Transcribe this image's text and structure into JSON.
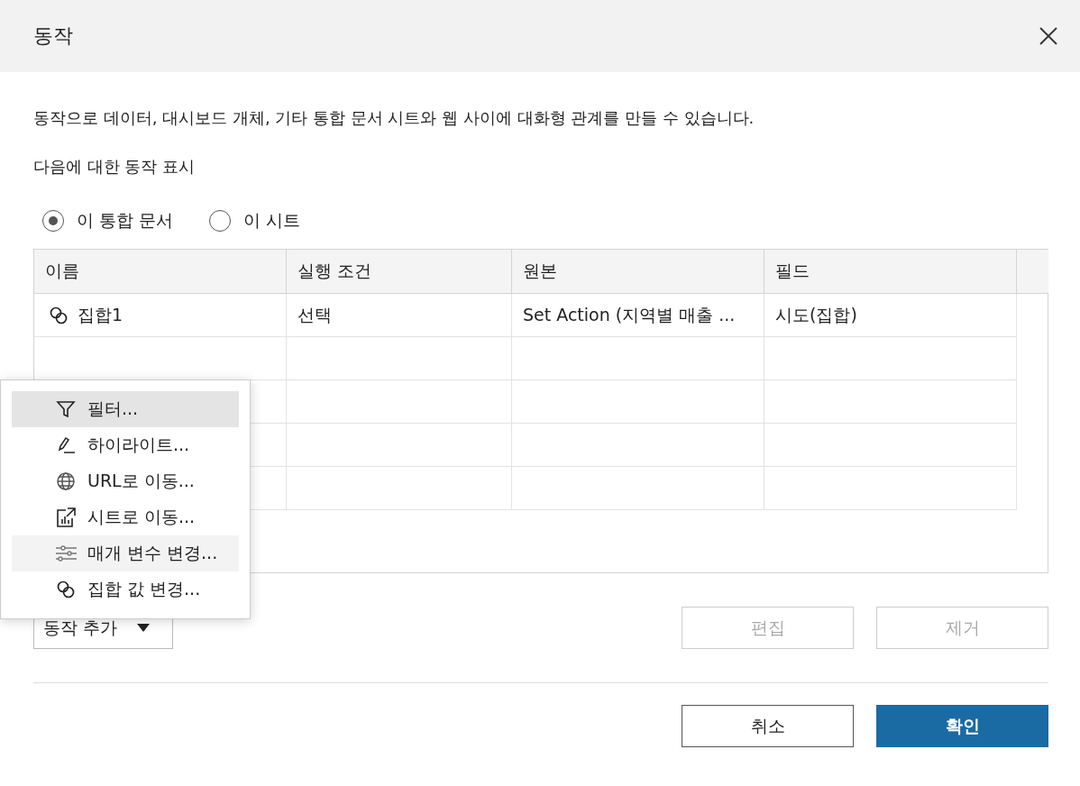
{
  "window": {
    "title": "동작"
  },
  "description": "동작으로 데이터, 대시보드 개체, 기타 통합 문서 시트와 웹 사이에 대화형 관계를 만들 수 있습니다.",
  "show_label": "다음에 대한 동작 표시",
  "scope_options": [
    {
      "label": "이 통합 문서",
      "selected": true
    },
    {
      "label": "이 시트",
      "selected": false
    }
  ],
  "table": {
    "columns": [
      "이름",
      "실행 조건",
      "원본",
      "필드"
    ],
    "rows": [
      {
        "kind": "set",
        "cells": [
          "집합1",
          "선택",
          "Set Action (지역별 매출 ...",
          "시도(집합)"
        ]
      }
    ]
  },
  "add_menu": {
    "items": [
      {
        "kind": "filter",
        "label": "필터...",
        "selected": true,
        "hovered": false
      },
      {
        "kind": "highlight",
        "label": "하이라이트...",
        "selected": false,
        "hovered": false
      },
      {
        "kind": "url",
        "label": "URL로 이동...",
        "selected": false,
        "hovered": false
      },
      {
        "kind": "sheet",
        "label": "시트로 이동...",
        "selected": false,
        "hovered": false
      },
      {
        "kind": "parameter",
        "label": "매개 변수 변경...",
        "selected": false,
        "hovered": true
      },
      {
        "kind": "set",
        "label": "집합 값 변경...",
        "selected": false,
        "hovered": false
      }
    ]
  },
  "add_button": {
    "label": "동작 추가"
  },
  "row_buttons": [
    {
      "label": "편집",
      "disabled": true
    },
    {
      "label": "제거",
      "disabled": true
    }
  ],
  "footer_buttons": [
    {
      "label": "취소",
      "kind": "secondary"
    },
    {
      "label": "확인",
      "kind": "primary"
    }
  ]
}
